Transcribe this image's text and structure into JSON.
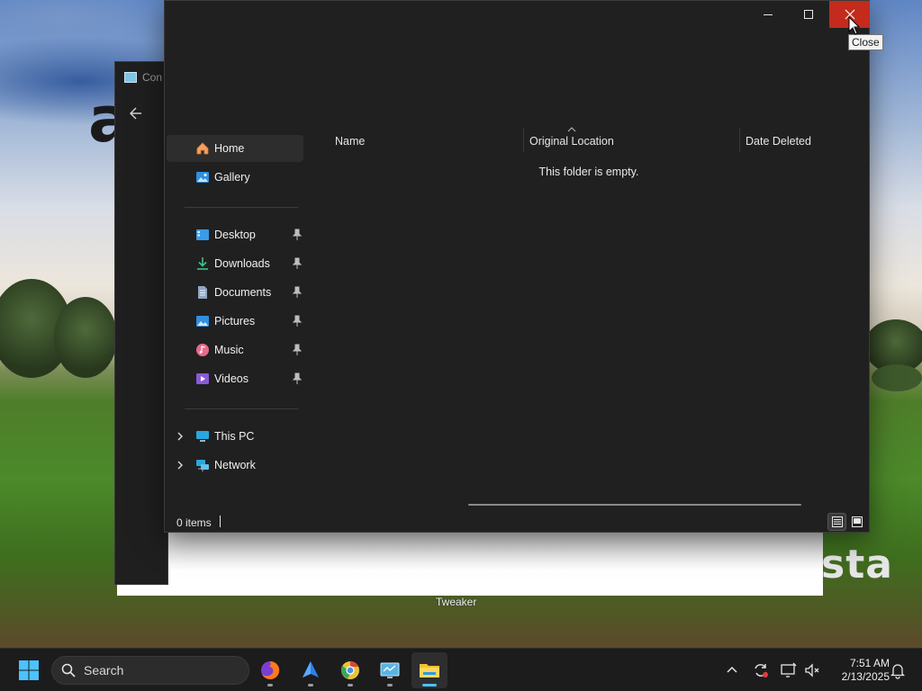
{
  "background_window": {
    "title": "Con",
    "label": "Tweaker",
    "wallpaper_text_left": "a",
    "wallpaper_text_right": "sta"
  },
  "explorer": {
    "caption": {
      "minimize_icon": "minimize-icon",
      "maximize_icon": "maximize-icon",
      "close_icon": "close-icon"
    },
    "tooltip": "Close",
    "nav": {
      "quick": [
        {
          "label": "Home",
          "icon": "home-icon",
          "selected": true
        },
        {
          "label": "Gallery",
          "icon": "gallery-icon"
        }
      ],
      "pinned": [
        {
          "label": "Desktop",
          "icon": "desktop-icon"
        },
        {
          "label": "Downloads",
          "icon": "downloads-icon"
        },
        {
          "label": "Documents",
          "icon": "documents-icon"
        },
        {
          "label": "Pictures",
          "icon": "pictures-icon"
        },
        {
          "label": "Music",
          "icon": "music-icon"
        },
        {
          "label": "Videos",
          "icon": "videos-icon"
        }
      ],
      "tree": [
        {
          "label": "This PC",
          "icon": "this-pc-icon"
        },
        {
          "label": "Network",
          "icon": "network-icon"
        }
      ]
    },
    "columns": {
      "name": "Name",
      "original_location": "Original Location",
      "date_deleted": "Date Deleted"
    },
    "empty_message": "This folder is empty.",
    "status": {
      "item_count": "0 items"
    }
  },
  "taskbar": {
    "search_placeholder": "Search",
    "apps": [
      "start-icon",
      "firefox-icon",
      "app-blue-icon",
      "chrome-icon",
      "control-panel-icon",
      "file-explorer-icon"
    ],
    "clock": {
      "time": "7:51 AM",
      "date": "2/13/2025"
    }
  },
  "colors": {
    "close_hover": "#c42b1c",
    "explorer_bg": "#202020",
    "taskbar_bg": "#1c1c1c",
    "accent": "#4cc2ff"
  }
}
